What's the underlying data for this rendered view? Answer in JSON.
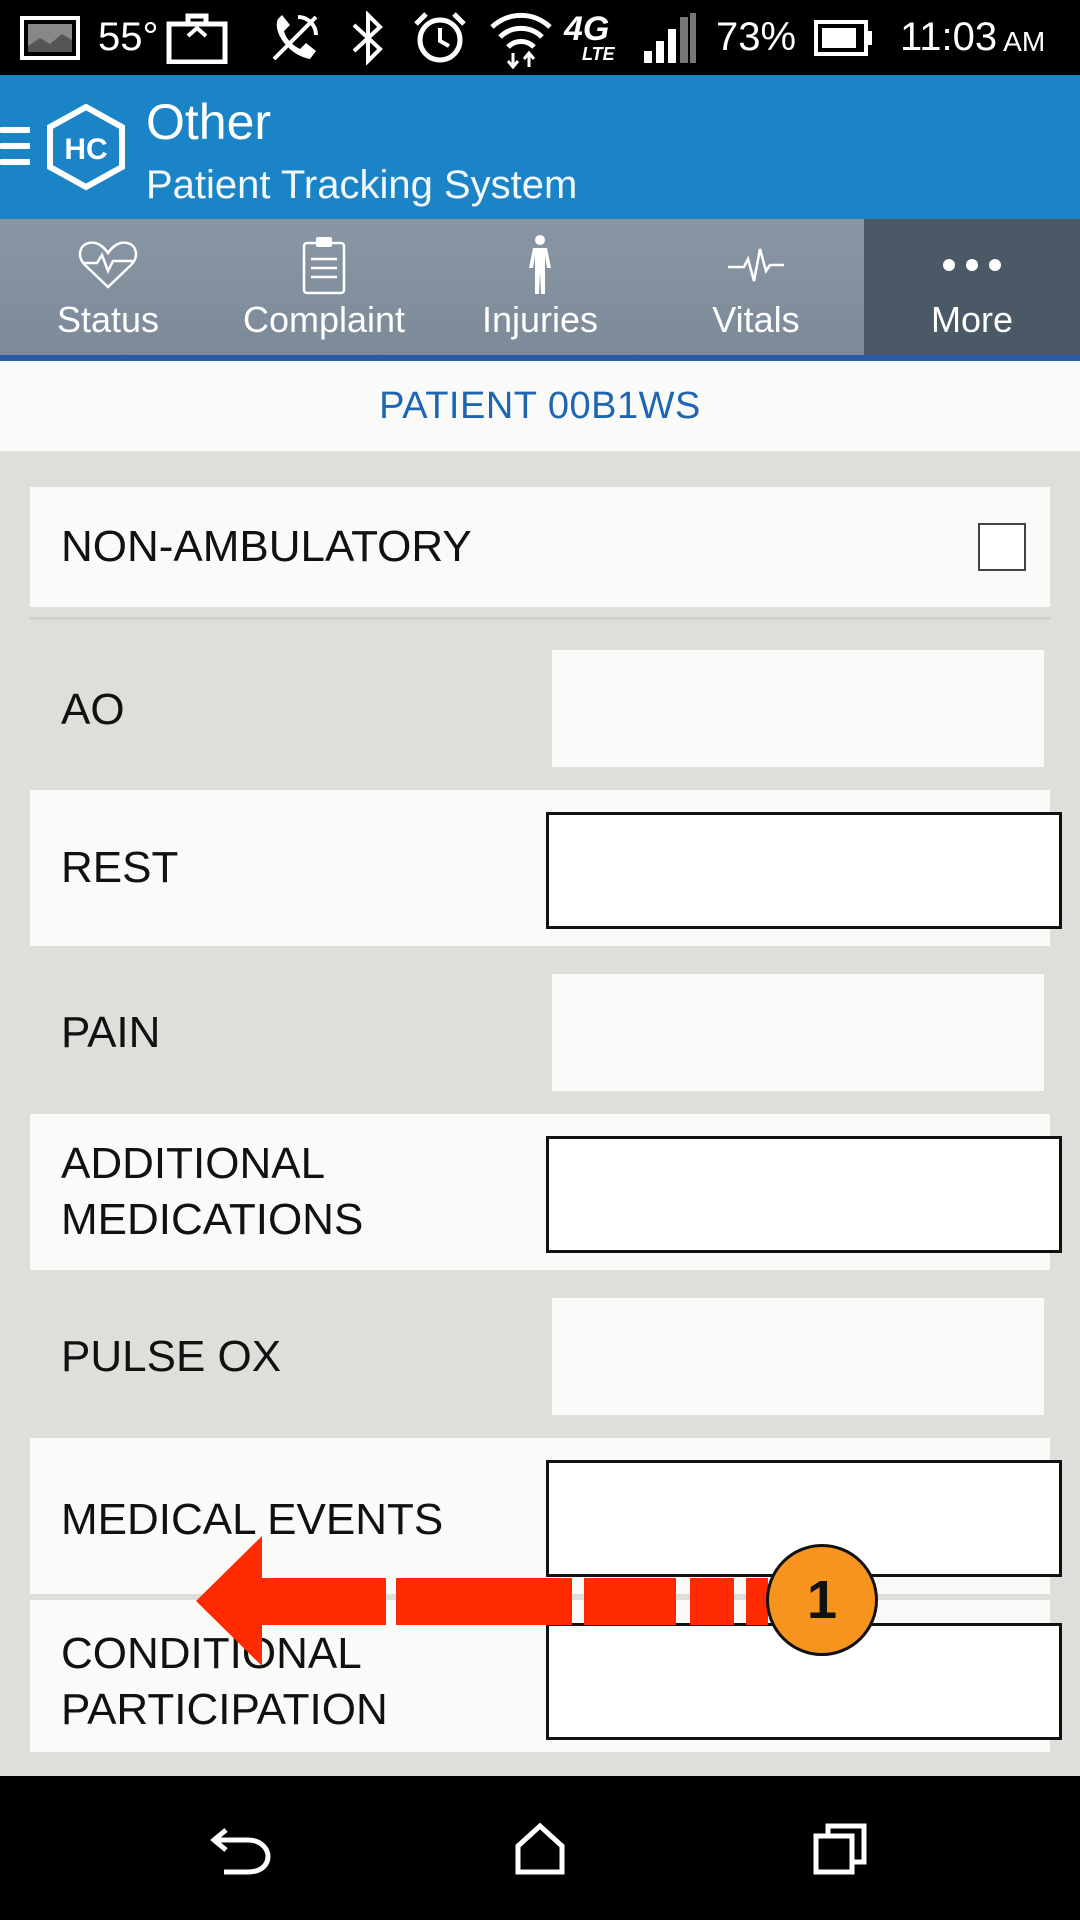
{
  "status_bar": {
    "temperature": "55°",
    "battery_percent": "73%",
    "time": "11:03",
    "ampm": "AM",
    "network": "4G",
    "network_sub": "LTE",
    "icons": [
      "image-icon",
      "briefcase-icon",
      "phone-mute-icon",
      "bluetooth-icon",
      "alarm-icon",
      "wifi-icon",
      "lte-icon",
      "signal-icon",
      "battery-icon"
    ]
  },
  "app_bar": {
    "title": "Other",
    "subtitle": "Patient Tracking System",
    "logo_text": "HC",
    "color": "#1a84c6"
  },
  "tabs": [
    {
      "label": "Status",
      "icon": "heart-pulse-icon",
      "active": false
    },
    {
      "label": "Complaint",
      "icon": "clipboard-icon",
      "active": false
    },
    {
      "label": "Injuries",
      "icon": "body-icon",
      "active": false
    },
    {
      "label": "Vitals",
      "icon": "pulse-icon",
      "active": false
    },
    {
      "label": "More",
      "icon": "more-dots-icon",
      "active": true
    }
  ],
  "patient_header": "PATIENT 00B1WS",
  "form": {
    "non_ambulatory": {
      "label": "NON-AMBULATORY",
      "checked": false
    },
    "fields": [
      {
        "label": "AO",
        "value": ""
      },
      {
        "label": "REST",
        "value": ""
      },
      {
        "label": "PAIN",
        "value": ""
      },
      {
        "label_line1": "ADDITIONAL",
        "label_line2": "MEDICATIONS",
        "value": ""
      },
      {
        "label": "PULSE OX",
        "value": ""
      },
      {
        "label": "MEDICAL EVENTS",
        "value": ""
      },
      {
        "label_line1": "CONDITIONAL",
        "label_line2": "PARTICIPATION",
        "value": ""
      }
    ]
  },
  "overlay": {
    "step_number": "1",
    "gesture": "swipe-left",
    "arrow_color": "#ff2a00",
    "badge_color": "#f7941d"
  },
  "nav_bar": {
    "buttons": [
      "back-icon",
      "home-icon",
      "recents-icon"
    ]
  }
}
